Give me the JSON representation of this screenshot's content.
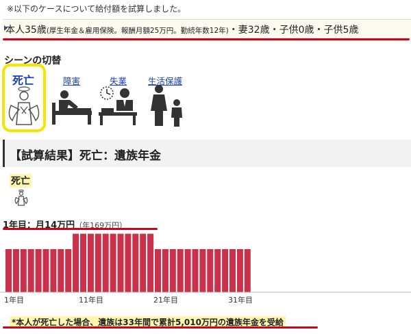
{
  "note": "※以下のケースについて給付額を試算しました。",
  "profile": {
    "person": "本人35歳",
    "detail": "(厚生年金＆雇用保険。報酬月額25万円。勤続年数12年)",
    "family": "・妻32歳・子供0歳・子供5歳"
  },
  "scene": {
    "title": "シーンの切替",
    "items": [
      {
        "label": "死亡",
        "icon": "angel-icon",
        "selected": true
      },
      {
        "label": "障害",
        "icon": "bedridden-icon",
        "selected": false
      },
      {
        "label": "失業",
        "icon": "unemployed-icon",
        "selected": false
      },
      {
        "label": "生活保護",
        "icon": "family-icon",
        "selected": false
      }
    ]
  },
  "result": {
    "title": "【試算結果】死亡：遺族年金",
    "sub_label": "死亡",
    "amount_main": "1年目：月14万円",
    "amount_annual": "（年169万円）",
    "summary": "*本人が死亡した場合、遺族は33年間で累計5,010万円の遺族年金を受給"
  },
  "colors": {
    "bar": "#c9324a",
    "highlight": "#f4e600",
    "underline": "#d4001a",
    "link": "#1a3fb8"
  },
  "chart_data": {
    "type": "bar",
    "x_ticks": [
      "1年目",
      "11年目",
      "21年目",
      "31年目"
    ],
    "values": [
      14,
      14,
      14,
      14,
      14,
      14,
      14,
      14,
      14,
      19,
      19,
      19,
      19,
      19,
      19,
      19,
      19,
      19,
      19,
      19,
      14,
      14,
      14,
      14,
      14,
      14,
      14,
      14,
      14,
      14,
      14,
      14,
      14
    ],
    "ylim": [
      0,
      20
    ]
  }
}
